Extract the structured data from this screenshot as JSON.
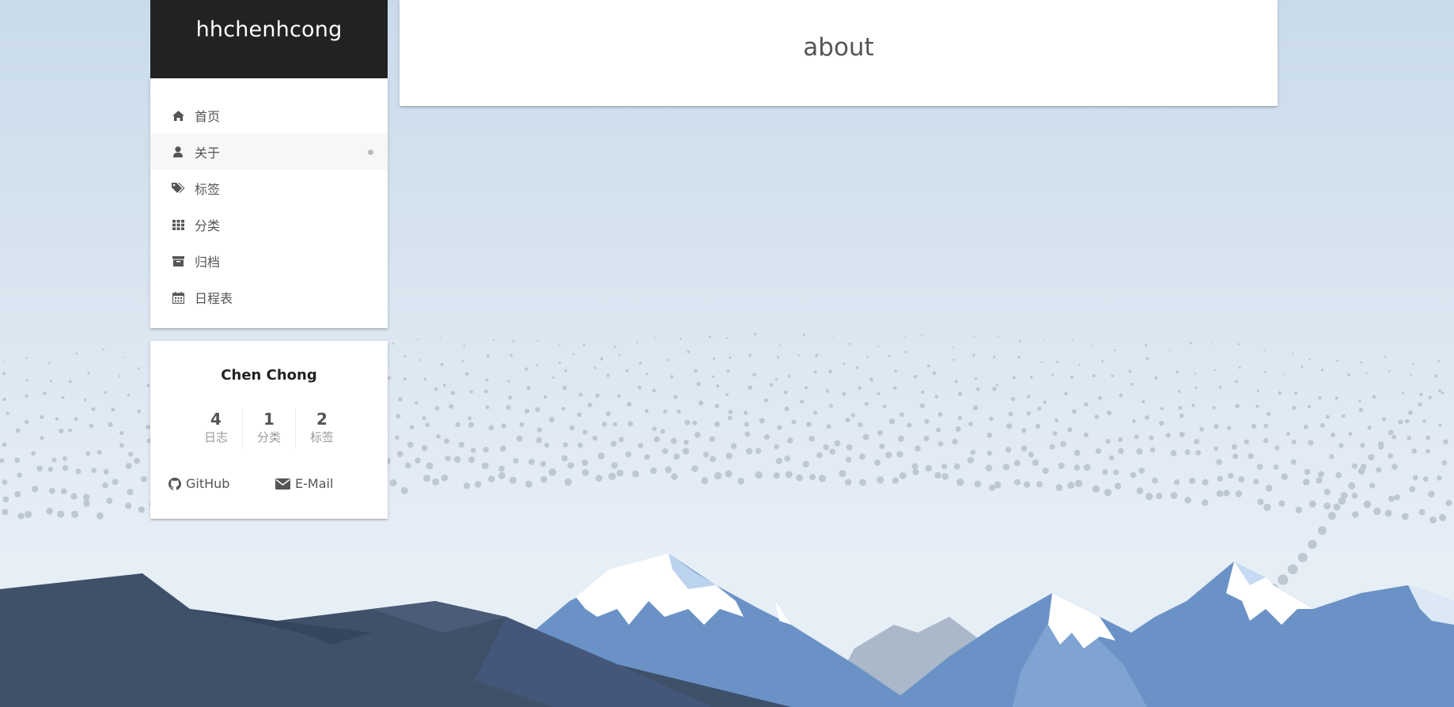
{
  "site": {
    "title": "hhchenhcong"
  },
  "menu": {
    "items": [
      {
        "label": "首页",
        "icon": "home-icon",
        "active": false
      },
      {
        "label": "关于",
        "icon": "user-icon",
        "active": true
      },
      {
        "label": "标签",
        "icon": "tags-icon",
        "active": false
      },
      {
        "label": "分类",
        "icon": "th-icon",
        "active": false
      },
      {
        "label": "归档",
        "icon": "archive-icon",
        "active": false
      },
      {
        "label": "日程表",
        "icon": "calendar-icon",
        "active": false
      }
    ]
  },
  "profile": {
    "author": "Chen Chong",
    "stats": [
      {
        "count": "4",
        "label": "日志"
      },
      {
        "count": "1",
        "label": "分类"
      },
      {
        "count": "2",
        "label": "标签"
      }
    ],
    "links": [
      {
        "label": "GitHub",
        "icon": "github-icon"
      },
      {
        "label": "E-Mail",
        "icon": "envelope-icon"
      }
    ]
  },
  "page": {
    "title": "about"
  },
  "colors": {
    "brand_bg": "#222222",
    "text": "#555555",
    "muted": "#999999",
    "mountain_dark": "#3f5069",
    "mountain_blue": "#6a92c6",
    "snow": "#ffffff"
  }
}
